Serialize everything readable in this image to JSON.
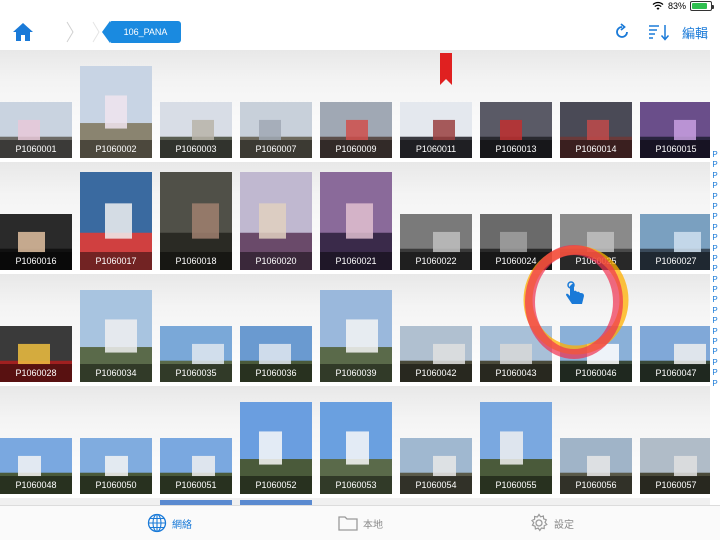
{
  "status": {
    "battery_text": "83%"
  },
  "nav": {
    "current_folder": "106_PANA",
    "edit_label": "編輯"
  },
  "photos": {
    "row1": [
      "P1060001",
      "P1060002",
      "P1060003",
      "P1060007",
      "P1060009",
      "P1060011",
      "P1060013",
      "P1060014",
      "P1060015"
    ],
    "row2": [
      "P1060016",
      "P1060017",
      "P1060018",
      "P1060020",
      "P1060021",
      "P1060022",
      "P1060024",
      "P1060025",
      "P1060027"
    ],
    "row3": [
      "P1060028",
      "P1060034",
      "P1060035",
      "P1060036",
      "P1060039",
      "P1060042",
      "P1060043",
      "P1060046",
      "P1060047"
    ],
    "row4": [
      "P1060048",
      "P1060050",
      "P1060051",
      "P1060052",
      "P1060053",
      "P1060054",
      "P1060055",
      "P1060056",
      "P1060057"
    ]
  },
  "index_strip": [
    "P",
    "P",
    "P",
    "P",
    "P",
    "P",
    "P",
    "P",
    "P",
    "P",
    "P",
    "P",
    "P",
    "P",
    "P",
    "P",
    "P",
    "P",
    "P",
    "P",
    "P",
    "P",
    "P"
  ],
  "tabs": {
    "network": "網絡",
    "local": "本地",
    "settings": "設定"
  },
  "colors": {
    "accent": "#1a7ad8",
    "crumb": "#1a8ae0",
    "bookmark": "#e02020",
    "touch_ring": "#f04040"
  }
}
